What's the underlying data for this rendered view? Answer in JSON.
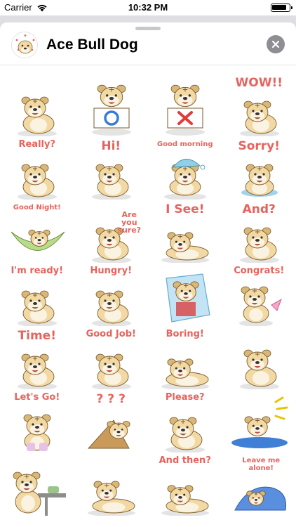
{
  "status_bar": {
    "carrier": "Carrier",
    "time": "10:32 PM",
    "battery_level": 0.85
  },
  "header": {
    "title": "Ace Bull Dog",
    "icon": "bulldog-app-icon",
    "close_icon": "close-x-icon"
  },
  "stickers": [
    {
      "name": "sticker-sitting",
      "caption": ""
    },
    {
      "name": "sticker-sign-o",
      "caption": "",
      "sign": "O"
    },
    {
      "name": "sticker-sign-x",
      "caption": "",
      "sign": "X"
    },
    {
      "name": "sticker-wow",
      "caption": "WOW!!"
    },
    {
      "name": "sticker-really",
      "caption": "Really?"
    },
    {
      "name": "sticker-hi",
      "caption": "Hi!"
    },
    {
      "name": "sticker-good-morning",
      "caption": "Good morning"
    },
    {
      "name": "sticker-sorry",
      "caption": "Sorry!"
    },
    {
      "name": "sticker-good-night",
      "caption": "Good Night!"
    },
    {
      "name": "sticker-are-you-sure",
      "caption": "Are you sure?"
    },
    {
      "name": "sticker-i-see",
      "caption": "I See!"
    },
    {
      "name": "sticker-and",
      "caption": "And?"
    },
    {
      "name": "sticker-im-ready",
      "caption": "I'm ready!"
    },
    {
      "name": "sticker-hungry",
      "caption": "Hungry!"
    },
    {
      "name": "sticker-frozen",
      "caption": ""
    },
    {
      "name": "sticker-congrats",
      "caption": "Congrats!"
    },
    {
      "name": "sticker-time",
      "caption": "Time!"
    },
    {
      "name": "sticker-good-job",
      "caption": "Good Job!"
    },
    {
      "name": "sticker-boring",
      "caption": "Boring!"
    },
    {
      "name": "sticker-sulking",
      "caption": ""
    },
    {
      "name": "sticker-lets-go",
      "caption": "Let's Go!"
    },
    {
      "name": "sticker-question",
      "caption": "? ? ?"
    },
    {
      "name": "sticker-please",
      "caption": "Please?"
    },
    {
      "name": "sticker-surfing",
      "caption": ""
    },
    {
      "name": "sticker-leaning",
      "caption": ""
    },
    {
      "name": "sticker-lying",
      "caption": ""
    },
    {
      "name": "sticker-and-then",
      "caption": "And then?"
    },
    {
      "name": "sticker-leave-me-alone",
      "caption": "Leave me alone!"
    }
  ],
  "colors": {
    "caption": "#e8635d",
    "fur": "#f2d9a4",
    "fur_dark": "#d9b877",
    "shadow": "#e4e4e4",
    "close_button": "#8e8e93"
  }
}
